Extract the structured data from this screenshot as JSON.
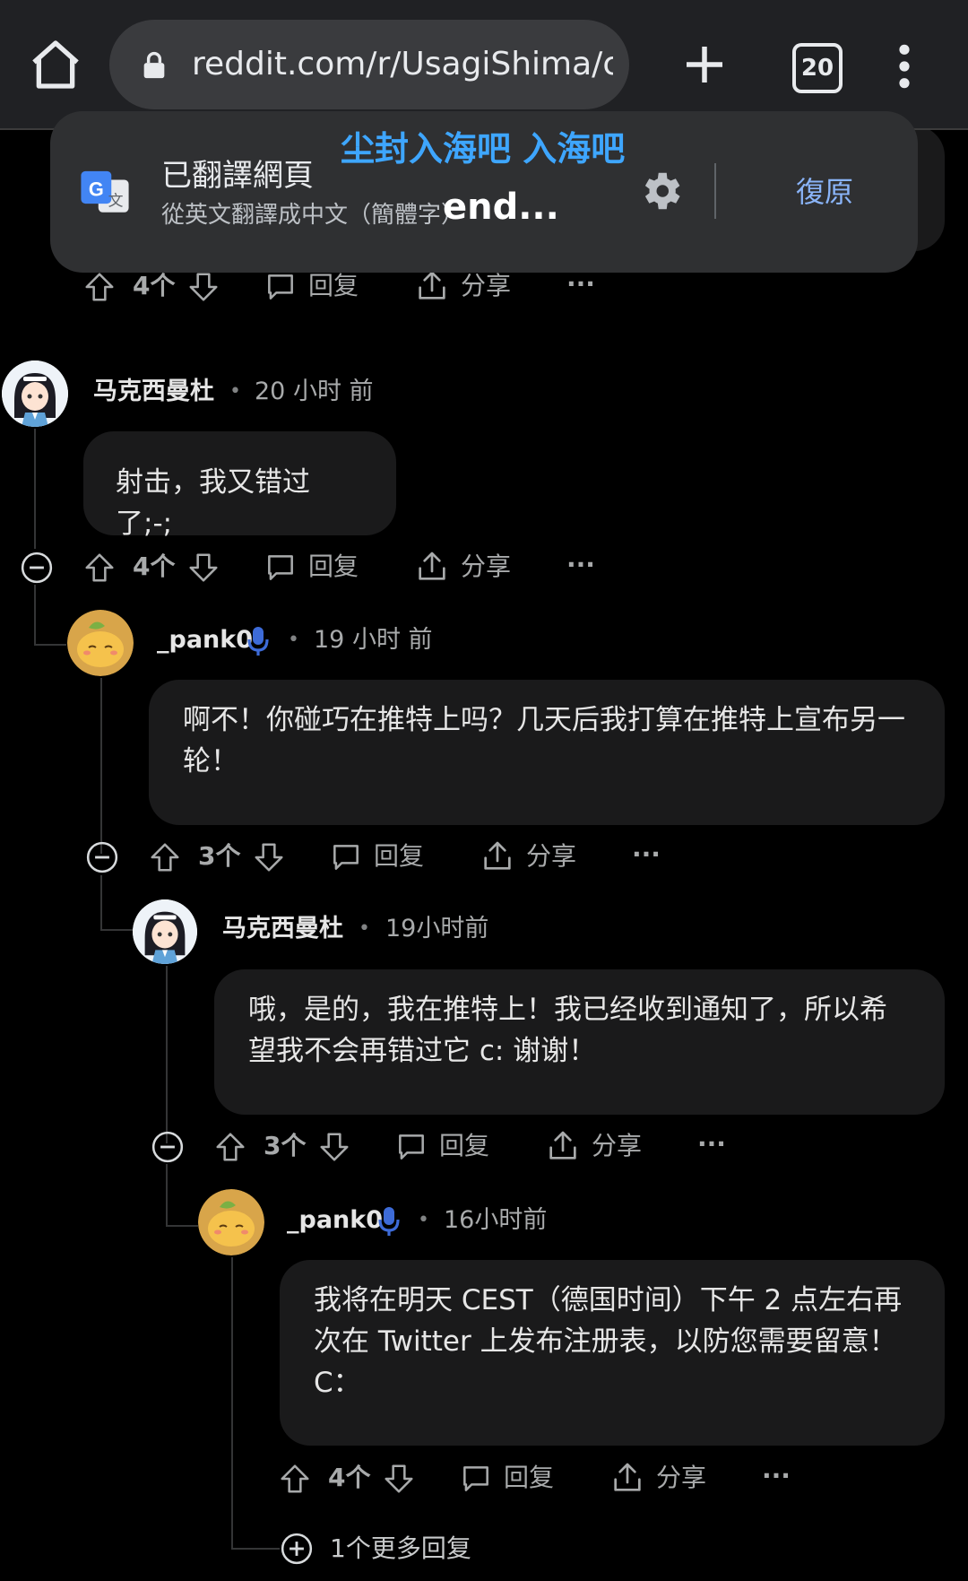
{
  "browser": {
    "url": "reddit.com/r/UsagiShima/com",
    "tab_count": "20"
  },
  "translate": {
    "title": "已翻譯網頁",
    "subtitle": "從英文翻譯成中文（簡體字）",
    "overlay_cn": "尘封入海吧 入海吧",
    "overlay_en": "end...",
    "restore_label": "復原"
  },
  "actions": {
    "reply_label": "回复",
    "share_label": "分享",
    "more_label": "···"
  },
  "top_actions": {
    "votes": "4个"
  },
  "comments": [
    {
      "author": "马克西曼杜",
      "time": "20 小时 前",
      "text": "射击，我又错过了;-;",
      "votes": "4个"
    },
    {
      "author": "_pank0",
      "time": "19 小时 前",
      "text": "啊不！你碰巧在推特上吗？几天后我打算在推特上宣布另一轮！",
      "votes": "3个"
    },
    {
      "author": "马克西曼杜",
      "time": "19小时前",
      "text": "哦，是的，我在推特上！我已经收到通知了，所以希望我不会再错过它 c: 谢谢！",
      "votes": "3个"
    },
    {
      "author": "_pank0",
      "time": "16小时前",
      "text": "我将在明天 CEST（德国时间）下午 2 点左右再次在 Twitter 上发布注册表，以防您需要留意！C：",
      "votes": "4个"
    }
  ],
  "more_replies_label": "1个更多回复",
  "colors": {
    "accent_blue": "#3ea6ff",
    "link_blue": "#8ab4f8",
    "mic_blue": "#3d6bd8",
    "bubble_bg": "#1a1a1b"
  }
}
